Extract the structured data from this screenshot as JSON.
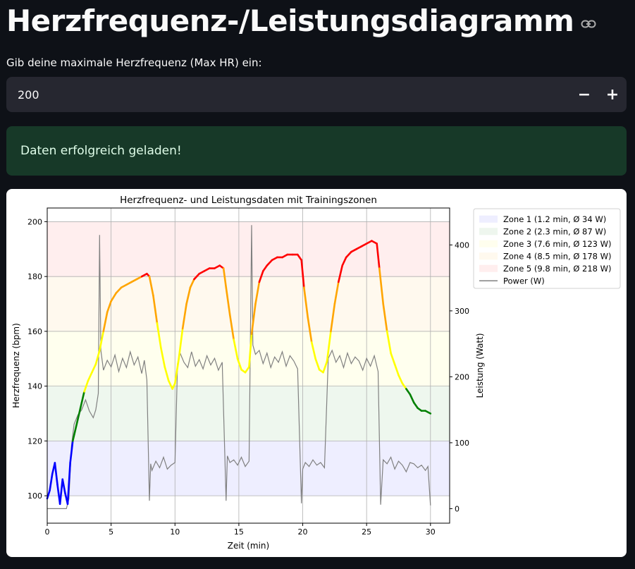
{
  "page": {
    "title": "Herzfrequenz-/Leistungsdiagramm",
    "anchor_icon": "link-icon"
  },
  "max_hr": {
    "label": "Gib deine maximale Herzfrequenz (Max HR) ein:",
    "value": "200",
    "decrement_label": "−",
    "increment_label": "+"
  },
  "alert": {
    "message": "Daten erfolgreich geladen!",
    "color": "#173928"
  },
  "chart_data": {
    "type": "line",
    "title": "Herzfrequenz- und Leistungsdaten mit Trainingszonen",
    "xlabel": "Zeit (min)",
    "ylabel_left": "Herzfrequenz (bpm)",
    "ylabel_right": "Leistung (Watt)",
    "xlim": [
      0,
      31.5
    ],
    "ylim_left": [
      90,
      205
    ],
    "ylim_right": [
      -22,
      456
    ],
    "x_ticks": [
      0,
      5,
      10,
      15,
      20,
      25,
      30
    ],
    "y_ticks_left": [
      100,
      120,
      140,
      160,
      180,
      200
    ],
    "y_ticks_right": [
      0,
      100,
      200,
      300,
      400
    ],
    "grid": true,
    "legend_position": "outside-right",
    "zones": [
      {
        "name": "Zone 1 (1.2 min, Ø 34 W)",
        "min": 100,
        "max": 120,
        "color": "#0000ff",
        "bar_color": "#eeeeff"
      },
      {
        "name": "Zone 2 (2.3 min, Ø 87 W)",
        "min": 120,
        "max": 140,
        "color": "#008000",
        "bar_color": "#eef6ee"
      },
      {
        "name": "Zone 3 (7.6 min, Ø 123 W)",
        "min": 140,
        "max": 160,
        "color": "#ffff00",
        "bar_color": "#fffeee"
      },
      {
        "name": "Zone 4 (8.5 min, Ø 178 W)",
        "min": 160,
        "max": 180,
        "color": "#ffa500",
        "bar_color": "#fff9ee"
      },
      {
        "name": "Zone 5 (9.8 min, Ø 218 W)",
        "min": 180,
        "max": 200,
        "color": "#ff0000",
        "bar_color": "#ffeeee"
      }
    ],
    "power_series_name": "Power (W)",
    "power_color": "#808080",
    "heart_rate": {
      "x": [
        0.0,
        0.2,
        0.4,
        0.6,
        0.8,
        1.0,
        1.2,
        1.4,
        1.6,
        1.8,
        2.0,
        2.3,
        2.6,
        2.9,
        3.2,
        3.5,
        3.8,
        4.1,
        4.4,
        4.7,
        5.0,
        5.4,
        5.8,
        6.2,
        6.6,
        7.0,
        7.4,
        7.8,
        8.0,
        8.3,
        8.6,
        8.9,
        9.2,
        9.5,
        9.8,
        10.0,
        10.3,
        10.6,
        10.9,
        11.2,
        11.5,
        11.9,
        12.3,
        12.7,
        13.1,
        13.5,
        13.8,
        14.0,
        14.3,
        14.6,
        14.9,
        15.2,
        15.5,
        15.8,
        16.0,
        16.3,
        16.6,
        16.9,
        17.2,
        17.6,
        18.0,
        18.4,
        18.8,
        19.2,
        19.6,
        19.9,
        20.1,
        20.4,
        20.7,
        21.0,
        21.3,
        21.6,
        21.9,
        22.2,
        22.5,
        22.8,
        23.1,
        23.4,
        23.8,
        24.2,
        24.6,
        25.0,
        25.4,
        25.8,
        26.0,
        26.3,
        26.6,
        26.9,
        27.2,
        27.5,
        27.8,
        28.1,
        28.4,
        28.7,
        29.0,
        29.3,
        29.6,
        30.0
      ],
      "y": [
        99,
        102,
        108,
        112,
        104,
        97,
        106,
        101,
        97,
        112,
        120,
        126,
        132,
        138,
        142,
        145,
        148,
        153,
        160,
        167,
        171,
        174,
        176,
        177,
        178,
        179,
        180,
        181,
        180,
        173,
        163,
        154,
        147,
        142,
        139,
        141,
        150,
        161,
        170,
        176,
        179,
        181,
        182,
        183,
        183,
        184,
        183,
        176,
        166,
        157,
        150,
        146,
        145,
        147,
        159,
        170,
        178,
        182,
        184,
        186,
        187,
        187,
        188,
        188,
        188,
        186,
        176,
        165,
        156,
        150,
        146,
        145,
        149,
        160,
        170,
        178,
        184,
        187,
        189,
        190,
        191,
        192,
        193,
        192,
        183,
        170,
        160,
        152,
        148,
        144,
        141,
        139,
        137,
        134,
        132,
        131,
        131,
        130
      ]
    },
    "power": {
      "x": [
        0.0,
        0.3,
        0.6,
        0.9,
        1.2,
        1.5,
        1.7,
        1.9,
        2.1,
        2.4,
        2.7,
        3.0,
        3.3,
        3.6,
        3.8,
        4.0,
        4.1,
        4.2,
        4.4,
        4.7,
        5.0,
        5.3,
        5.6,
        5.9,
        6.2,
        6.5,
        6.8,
        7.1,
        7.4,
        7.6,
        7.8,
        8.0,
        8.1,
        8.2,
        8.5,
        8.8,
        9.1,
        9.4,
        9.7,
        10.0,
        10.2,
        10.4,
        10.7,
        11.0,
        11.3,
        11.6,
        11.9,
        12.2,
        12.5,
        12.8,
        13.1,
        13.4,
        13.7,
        14.0,
        14.1,
        14.3,
        14.6,
        14.9,
        15.2,
        15.5,
        15.8,
        16.0,
        16.1,
        16.3,
        16.6,
        16.9,
        17.2,
        17.5,
        17.8,
        18.1,
        18.4,
        18.7,
        19.0,
        19.3,
        19.6,
        19.9,
        20.0,
        20.2,
        20.5,
        20.8,
        21.1,
        21.4,
        21.7,
        22.0,
        22.3,
        22.6,
        22.9,
        23.2,
        23.5,
        23.8,
        24.1,
        24.4,
        24.7,
        25.0,
        25.3,
        25.6,
        25.9,
        26.1,
        26.3,
        26.6,
        26.9,
        27.2,
        27.5,
        27.8,
        28.1,
        28.4,
        28.7,
        29.0,
        29.3,
        29.6,
        29.8,
        30.0
      ],
      "y": [
        0,
        0,
        0,
        0,
        0,
        0,
        15,
        95,
        128,
        142,
        150,
        165,
        148,
        138,
        150,
        175,
        415,
        240,
        210,
        225,
        215,
        233,
        208,
        228,
        214,
        238,
        218,
        230,
        205,
        225,
        195,
        12,
        68,
        58,
        72,
        62,
        78,
        60,
        66,
        70,
        220,
        236,
        222,
        214,
        238,
        216,
        226,
        212,
        232,
        218,
        228,
        210,
        222,
        12,
        80,
        70,
        74,
        66,
        78,
        64,
        72,
        430,
        248,
        234,
        240,
        220,
        236,
        214,
        230,
        222,
        238,
        216,
        232,
        224,
        212,
        8,
        60,
        70,
        64,
        74,
        66,
        70,
        62,
        228,
        240,
        222,
        232,
        214,
        236,
        220,
        230,
        224,
        210,
        228,
        216,
        232,
        208,
        6,
        74,
        68,
        78,
        60,
        72,
        66,
        56,
        70,
        68,
        62,
        66,
        58,
        64,
        5
      ]
    }
  }
}
